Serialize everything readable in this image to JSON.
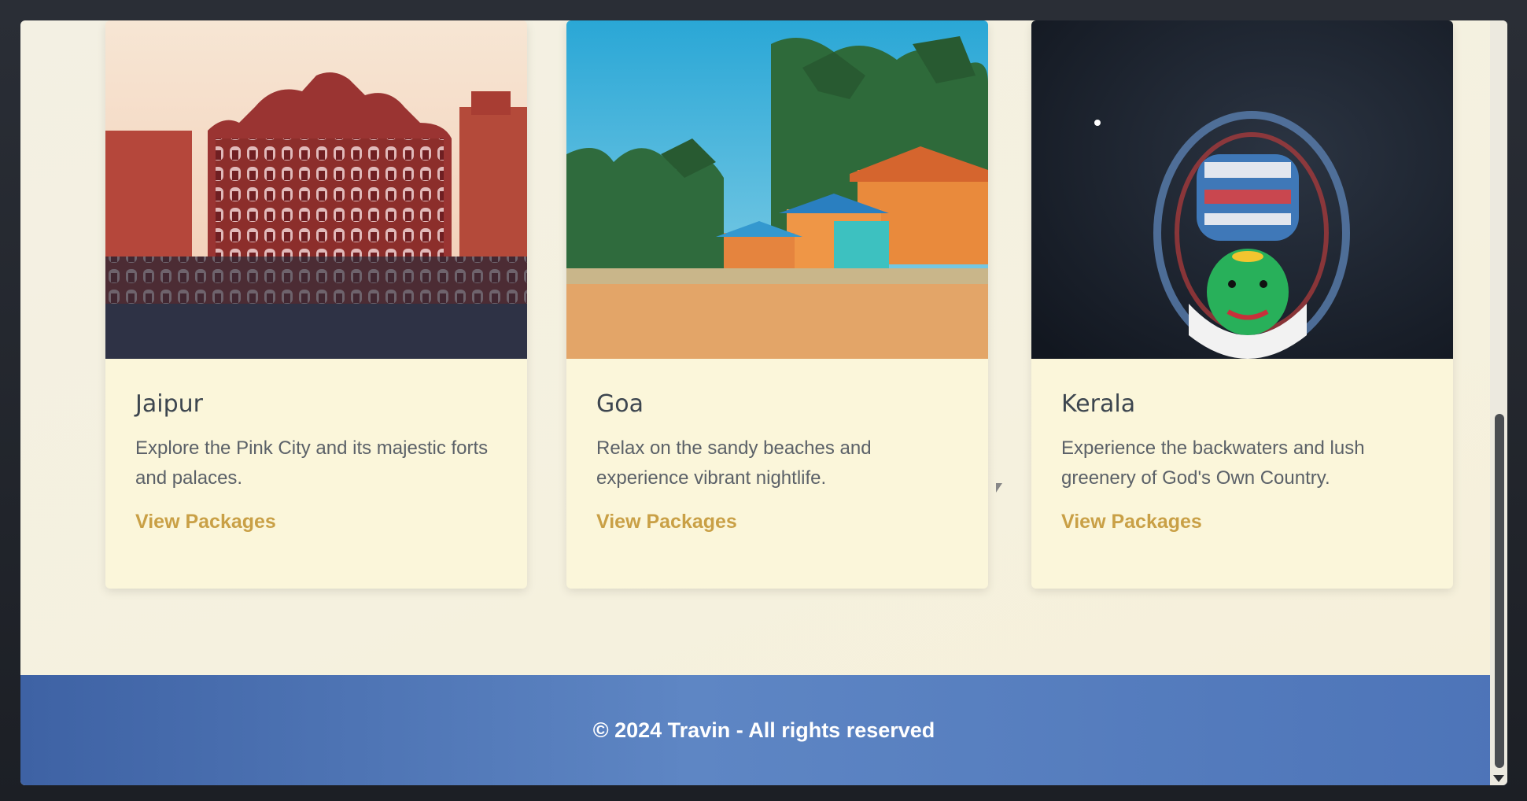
{
  "destinations": [
    {
      "title": "Jaipur",
      "description": "Explore the Pink City and its majestic forts and palaces.",
      "link_label": "View Packages",
      "image_icon": "palace-photo"
    },
    {
      "title": "Goa",
      "description": "Relax on the sandy beaches and experience vibrant nightlife.",
      "link_label": "View Packages",
      "image_icon": "beach-photo"
    },
    {
      "title": "Kerala",
      "description": "Experience the backwaters and lush greenery of God's Own Country.",
      "link_label": "View Packages",
      "image_icon": "kathakali-photo"
    }
  ],
  "footer": {
    "text": "© 2024 Travin - All rights reserved"
  },
  "colors": {
    "card_background": "#fbf6da",
    "link": "#c9a046",
    "footer_start": "#3e62a4",
    "footer_end": "#5e86c4"
  }
}
